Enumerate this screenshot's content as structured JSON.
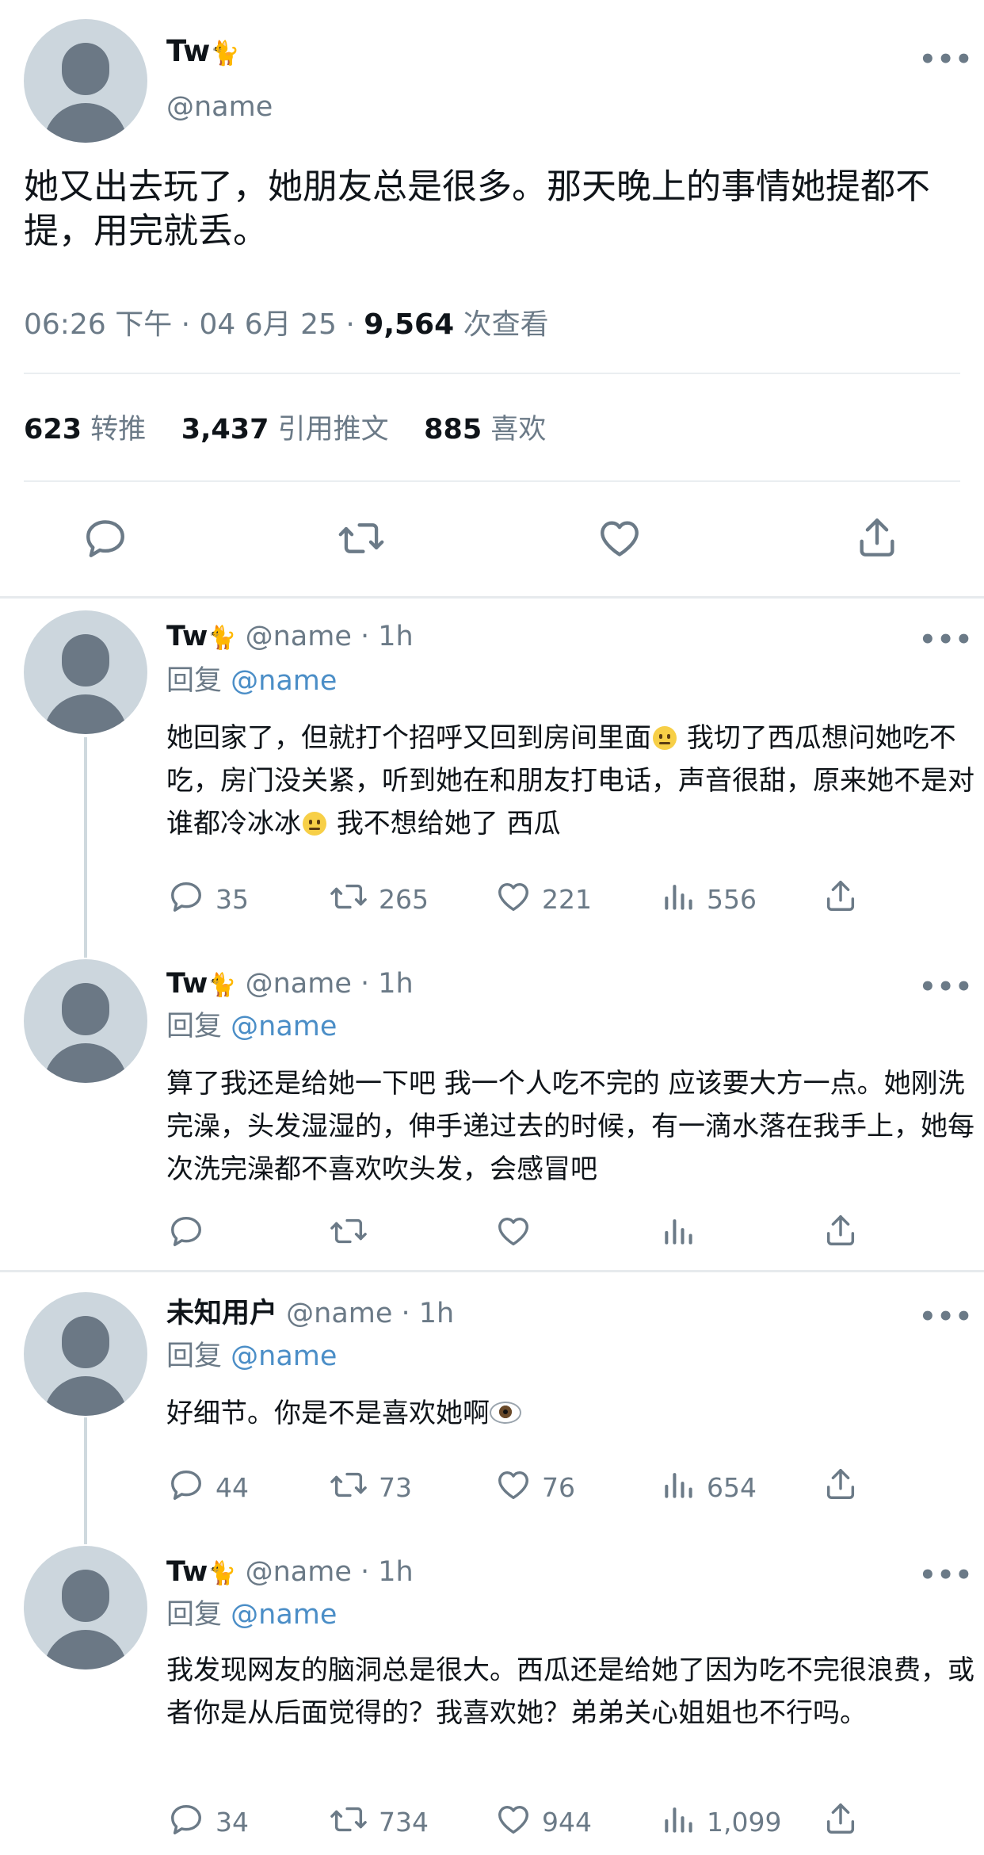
{
  "main_tweet": {
    "display_name": "Tw",
    "name_emoji": "🐈",
    "handle": "@name",
    "text": "她又出去玩了，她朋友总是很多。那天晚上的事情她提都不提，用完就丢。",
    "time": "06:26 下午 · 04 6月 25 · ",
    "views_count": "9,564",
    "views_label": " 次查看",
    "stats": {
      "retweets_count": "623",
      "retweets_label": "转推",
      "quotes_count": "3,437",
      "quotes_label": "引用推文",
      "likes_count": "885",
      "likes_label": "喜欢"
    },
    "actions": [
      "reply-icon",
      "retweet-icon",
      "like-icon",
      "share-icon"
    ]
  },
  "replies": [
    {
      "display_name": "Tw",
      "name_emoji": "🐈",
      "handle_time": "@name · 1h",
      "reply_prefix": "回复",
      "reply_to": "@name",
      "text_parts": [
        "她回家了，但就打个招呼又回到房间里面",
        "我切了西瓜想问她吃不吃，房门没关紧，听到她在和朋友打电话，声音很甜，原来她不是对谁都冷冰冰",
        "我不想给她了 西瓜"
      ],
      "counts": {
        "reply": "35",
        "retweet": "265",
        "like": "221",
        "views": "556"
      }
    },
    {
      "display_name": "Tw",
      "name_emoji": "🐈",
      "handle_time": "@name · 1h",
      "reply_prefix": "回复",
      "reply_to": "@name",
      "text": "算了我还是给她一下吧 我一个人吃不完的 应该要大方一点。她刚洗完澡，头发湿湿的，伸手递过去的时候，有一滴水落在我手上，她每次洗完澡都不喜欢吹头发，会感冒吧",
      "counts": {
        "reply": "",
        "retweet": "",
        "like": "",
        "views": ""
      }
    },
    {
      "display_name": "未知用户",
      "handle_time": "@name · 1h",
      "reply_prefix": "回复",
      "reply_to": "@name",
      "text": "好细节。你是不是喜欢她啊",
      "counts": {
        "reply": "44",
        "retweet": "73",
        "like": "76",
        "views": "654"
      }
    },
    {
      "display_name": "Tw",
      "name_emoji": "🐈",
      "handle_time": "@name · 1h",
      "reply_prefix": "回复",
      "reply_to": "@name",
      "text": "我发现网友的脑洞总是很大。西瓜还是给她了因为吃不完很浪费，或者你是从后面觉得的？我喜欢她？弟弟关心姐姐也不行吗。",
      "counts": {
        "reply": "34",
        "retweet": "734",
        "like": "944",
        "views": "1,099"
      }
    }
  ],
  "colors": {
    "text": "#0f1419",
    "secondary": "#6b7a87",
    "link": "#4b8ec7",
    "avatar_bg": "#ccd6dd",
    "avatar_fg": "#6b7885"
  }
}
